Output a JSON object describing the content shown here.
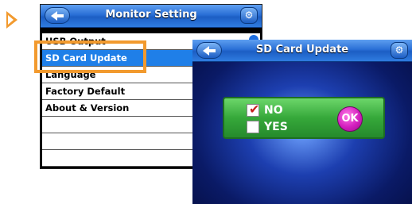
{
  "monitor_setting": {
    "title": "Monitor Setting",
    "tool_icon": "wrench-icon",
    "items": [
      {
        "label": "USB Output"
      },
      {
        "label": "SD Card Update"
      },
      {
        "label": "Language"
      },
      {
        "label": "Factory Default"
      },
      {
        "label": "About & Version"
      },
      {
        "label": ""
      },
      {
        "label": ""
      },
      {
        "label": ""
      }
    ],
    "selected_index": 1
  },
  "sd_card_update": {
    "title": "SD Card Update",
    "tool_icon": "wrench-icon",
    "options": [
      {
        "label": "NO",
        "checked": true
      },
      {
        "label": "YES",
        "checked": false
      }
    ],
    "ok_label": "OK"
  },
  "colors": {
    "accent": "#f29a2e",
    "titlebar": "#2a6fd6",
    "selection": "#1f7fe8",
    "dialog": "#36a83a",
    "ok_button": "#d31fbf"
  }
}
